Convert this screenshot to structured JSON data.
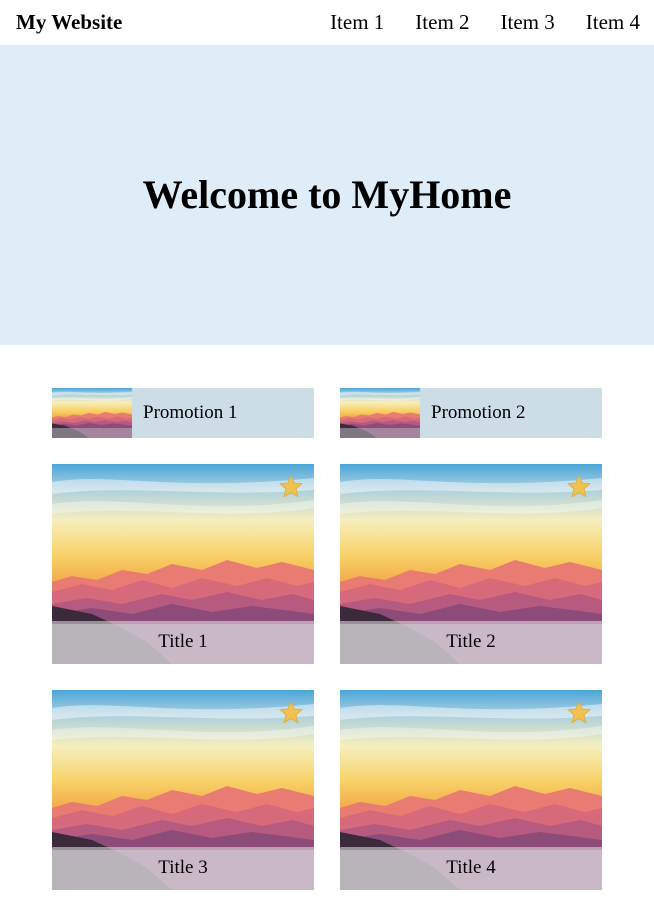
{
  "nav": {
    "brand": "My Website",
    "items": [
      {
        "label": "Item 1"
      },
      {
        "label": "Item 2"
      },
      {
        "label": "Item 3"
      },
      {
        "label": "Item 4"
      }
    ]
  },
  "hero": {
    "title": "Welcome to MyHome"
  },
  "promotions": [
    {
      "label": "Promotion 1",
      "image_icon": "sunset-mountains-thumbnail"
    },
    {
      "label": "Promotion 2",
      "image_icon": "sunset-mountains-thumbnail"
    }
  ],
  "cards": [
    {
      "title": "Title 1",
      "image_icon": "sunset-mountains-image",
      "favorite_icon": "star-icon"
    },
    {
      "title": "Title 2",
      "image_icon": "sunset-mountains-image",
      "favorite_icon": "star-icon"
    },
    {
      "title": "Title 3",
      "image_icon": "sunset-mountains-image",
      "favorite_icon": "star-icon"
    },
    {
      "title": "Title 4",
      "image_icon": "sunset-mountains-image",
      "favorite_icon": "star-icon"
    }
  ],
  "colors": {
    "hero_background": "#deedf7",
    "promo_background": "#cddde6",
    "star": "#f0c24f"
  }
}
